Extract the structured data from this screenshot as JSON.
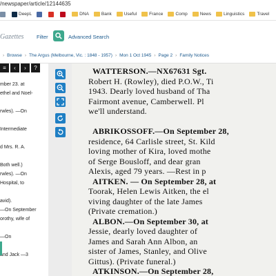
{
  "browser": {
    "url": "/newspaper/article/12144635",
    "bookmarks": [
      {
        "label": "",
        "icon": "globe-icon",
        "color": "#7b8fa6"
      },
      {
        "label": "DeepL",
        "icon": "deepl-icon",
        "color": "#0f2b46"
      },
      {
        "label": "",
        "icon": "grid-icon",
        "color": "#4a6aa5"
      },
      {
        "label": "",
        "icon": "mail-icon",
        "color": "#d93025"
      },
      {
        "label": "",
        "icon": "pinterest-icon",
        "color": "#bd081c"
      },
      {
        "label": "DNA",
        "icon": "folder-icon",
        "color": "#f0c24b"
      },
      {
        "label": "Bank",
        "icon": "folder-icon",
        "color": "#f0c24b"
      },
      {
        "label": "Useful",
        "icon": "folder-icon",
        "color": "#f0c24b"
      },
      {
        "label": "France",
        "icon": "folder-icon",
        "color": "#f0c24b"
      },
      {
        "label": "Comp",
        "icon": "folder-icon",
        "color": "#f0c24b"
      },
      {
        "label": "News",
        "icon": "folder-icon",
        "color": "#f0c24b"
      },
      {
        "label": "Linguistics",
        "icon": "folder-icon",
        "color": "#f0c24b"
      },
      {
        "label": "Travel",
        "icon": "folder-icon",
        "color": "#f0c24b"
      }
    ]
  },
  "header": {
    "site_name": "Gazettes",
    "filter_label": "Filter",
    "advanced_search_label": "Advanced Search",
    "accent_color": "#3ea88d"
  },
  "breadcrumb": {
    "items": [
      "Browse",
      "The Argus (Melbourne, Vic. : 1848 - 1957)",
      "Mon 1 Oct 1945",
      "Page 2",
      "Family Notices"
    ]
  },
  "left_panel": {
    "lines": [
      "mber 23. at",
      "ethel and Noel-",
      "",
      "rwles). —On",
      "",
      "Intermediate",
      "",
      "d Mrs. R. A.",
      "",
      "Both well.)",
      "rwles). —On",
      "Hospital, to",
      "",
      "avid).",
      "—On September",
      "orothy, wife of",
      "",
      "—On",
      "",
      "and Jack —3"
    ]
  },
  "viewer": {
    "tools": [
      "zoom-in-icon",
      "zoom-out-icon",
      "fit-icon",
      "rotate-right-icon",
      "rotate-left-icon"
    ],
    "lines": [
      "WATTERSON.—NX67631   Sgt.",
      "Robert H. (Rowley), died P.O.W., Ti",
      "1943.  Dearly loved husband of Tha",
      "Fairmont avenue, Camberwell.  Pl",
      "we'll understand.",
      "",
      "ABRIKOSSOFF.—On September 28,",
      "residence, 64 Carlisle street, St. Kild",
      "loving mother of Kira, loved mothe",
      "of Serge Bousloff, and dear gran",
      "Alexis, aged 79 years.  —Rest in p",
      "AITKEN. — On September 28, at",
      "Toorak, Helen Lewis Aitken, the el",
      "viving daughter of the late James",
      "(Private cremation.)",
      "ALBON.—On   September  30,  at",
      "Jessie, dearly loved daughter of",
      "James and Sarah Ann Albon, an",
      "sister of James, Stanley, and Olive",
      "Gittus).  (Private funeral.)",
      "ATKINSON.—On  September 28,"
    ]
  }
}
